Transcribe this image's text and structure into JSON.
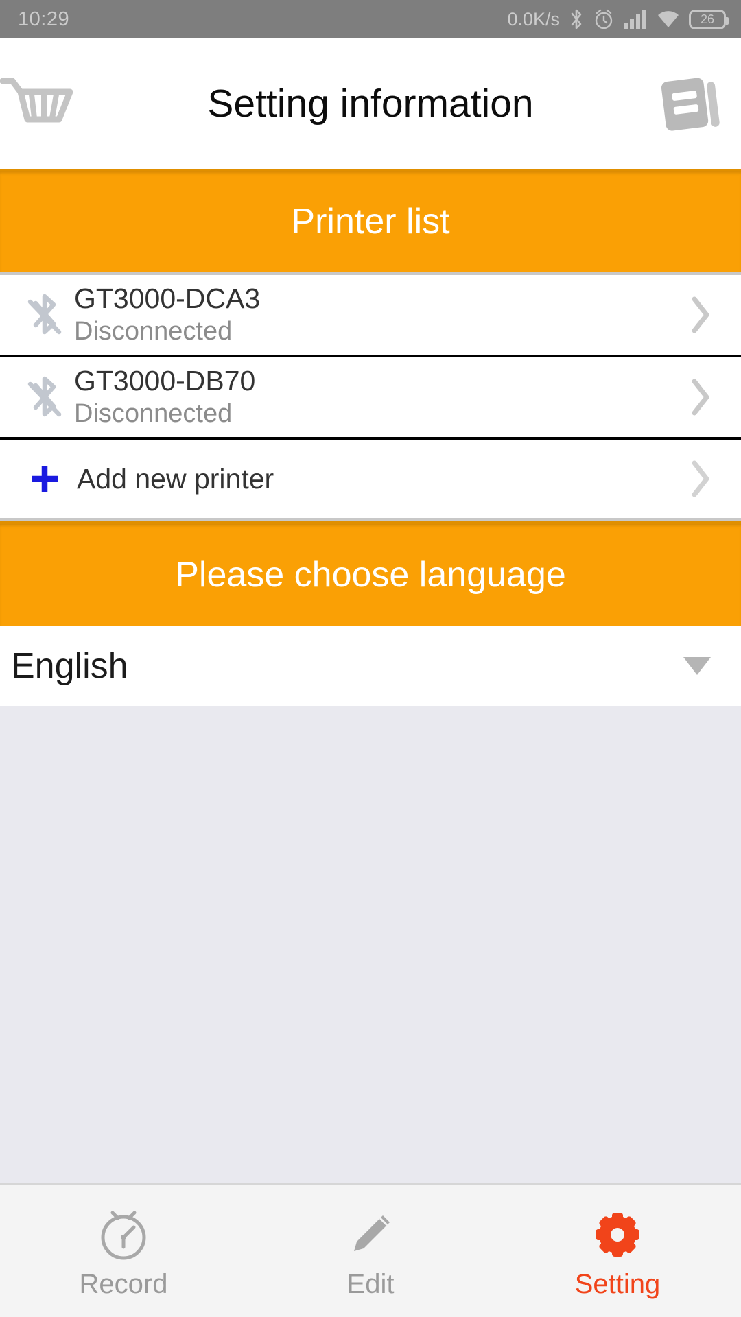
{
  "status_bar": {
    "time": "10:29",
    "network_speed": "0.0K/s",
    "battery_level": "26",
    "icons": [
      "bluetooth-icon",
      "alarm-icon",
      "signal-icon",
      "wifi-icon",
      "battery-icon"
    ]
  },
  "header": {
    "title": "Setting information",
    "left_icon": "shopping-cart-icon",
    "right_icon": "notebook-icon"
  },
  "printer_section": {
    "band_label": "Printer list",
    "printers": [
      {
        "name": "GT3000-DCA3",
        "status": "Disconnected",
        "icon": "bluetooth-off-icon"
      },
      {
        "name": "GT3000-DB70",
        "status": "Disconnected",
        "icon": "bluetooth-off-icon"
      }
    ],
    "add_label": "Add new printer",
    "add_icon": "plus-icon"
  },
  "language_section": {
    "band_label": "Please choose language",
    "selected": "English",
    "caret_icon": "caret-down-icon"
  },
  "bottom_nav": {
    "items": [
      {
        "label": "Record",
        "icon": "speedometer-icon",
        "active": false
      },
      {
        "label": "Edit",
        "icon": "pencil-icon",
        "active": false
      },
      {
        "label": "Setting",
        "icon": "gear-icon",
        "active": true
      }
    ]
  },
  "colors": {
    "accent_orange": "#faa005",
    "active_red": "#f1441a",
    "plus_blue": "#1a1ae0",
    "status_bar": "#7e7e7e",
    "content_bg": "#e9e9ef"
  }
}
